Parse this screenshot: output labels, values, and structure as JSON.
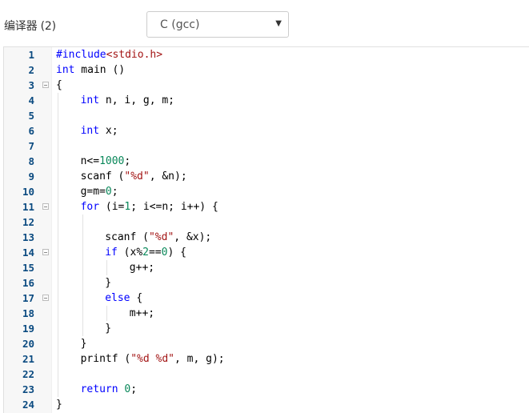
{
  "header": {
    "compiler_label": "编译器 (2)",
    "compiler_selected": "C (gcc)"
  },
  "editor": {
    "lines": [
      {
        "n": "1",
        "fold": false,
        "indent": 0,
        "tokens": [
          [
            "pre",
            "#include"
          ],
          [
            "inc",
            "<stdio.h>"
          ]
        ]
      },
      {
        "n": "2",
        "fold": false,
        "indent": 0,
        "tokens": [
          [
            "kw",
            "int"
          ],
          [
            "txt",
            " main ()"
          ]
        ]
      },
      {
        "n": "3",
        "fold": true,
        "indent": 0,
        "tokens": [
          [
            "txt",
            "{"
          ]
        ]
      },
      {
        "n": "4",
        "fold": false,
        "indent": 1,
        "tokens": [
          [
            "kw",
            "int"
          ],
          [
            "txt",
            " n, i, g, m;"
          ]
        ]
      },
      {
        "n": "5",
        "fold": false,
        "indent": 1,
        "tokens": []
      },
      {
        "n": "6",
        "fold": false,
        "indent": 1,
        "tokens": [
          [
            "kw",
            "int"
          ],
          [
            "txt",
            " x;"
          ]
        ]
      },
      {
        "n": "7",
        "fold": false,
        "indent": 1,
        "tokens": []
      },
      {
        "n": "8",
        "fold": false,
        "indent": 1,
        "tokens": [
          [
            "txt",
            "n<="
          ],
          [
            "num",
            "1000"
          ],
          [
            "txt",
            ";"
          ]
        ]
      },
      {
        "n": "9",
        "fold": false,
        "indent": 1,
        "tokens": [
          [
            "txt",
            "scanf ("
          ],
          [
            "str",
            "\"%d\""
          ],
          [
            "txt",
            ", &n);"
          ]
        ]
      },
      {
        "n": "10",
        "fold": false,
        "indent": 1,
        "tokens": [
          [
            "txt",
            "g=m="
          ],
          [
            "num",
            "0"
          ],
          [
            "txt",
            ";"
          ]
        ]
      },
      {
        "n": "11",
        "fold": true,
        "indent": 1,
        "tokens": [
          [
            "kw",
            "for"
          ],
          [
            "txt",
            " (i="
          ],
          [
            "num",
            "1"
          ],
          [
            "txt",
            "; i<=n; i++) {"
          ]
        ]
      },
      {
        "n": "12",
        "fold": false,
        "indent": 2,
        "tokens": []
      },
      {
        "n": "13",
        "fold": false,
        "indent": 2,
        "tokens": [
          [
            "txt",
            "scanf ("
          ],
          [
            "str",
            "\"%d\""
          ],
          [
            "txt",
            ", &x);"
          ]
        ]
      },
      {
        "n": "14",
        "fold": true,
        "indent": 2,
        "tokens": [
          [
            "kw",
            "if"
          ],
          [
            "txt",
            " (x%"
          ],
          [
            "num",
            "2"
          ],
          [
            "txt",
            "=="
          ],
          [
            "num",
            "0"
          ],
          [
            "txt",
            ") {"
          ]
        ]
      },
      {
        "n": "15",
        "fold": false,
        "indent": 3,
        "tokens": [
          [
            "txt",
            "g++;"
          ]
        ]
      },
      {
        "n": "16",
        "fold": false,
        "indent": 2,
        "tokens": [
          [
            "txt",
            "}"
          ]
        ]
      },
      {
        "n": "17",
        "fold": true,
        "indent": 2,
        "tokens": [
          [
            "kw",
            "else"
          ],
          [
            "txt",
            " {"
          ]
        ]
      },
      {
        "n": "18",
        "fold": false,
        "indent": 3,
        "tokens": [
          [
            "txt",
            "m++;"
          ]
        ]
      },
      {
        "n": "19",
        "fold": false,
        "indent": 2,
        "tokens": [
          [
            "txt",
            "}"
          ]
        ]
      },
      {
        "n": "20",
        "fold": false,
        "indent": 1,
        "tokens": [
          [
            "txt",
            "}"
          ]
        ]
      },
      {
        "n": "21",
        "fold": false,
        "indent": 1,
        "tokens": [
          [
            "txt",
            "printf ("
          ],
          [
            "str",
            "\"%d %d\""
          ],
          [
            "txt",
            ", m, g);"
          ]
        ]
      },
      {
        "n": "22",
        "fold": false,
        "indent": 1,
        "tokens": []
      },
      {
        "n": "23",
        "fold": false,
        "indent": 1,
        "tokens": [
          [
            "kw",
            "return"
          ],
          [
            "txt",
            " "
          ],
          [
            "num",
            "0"
          ],
          [
            "txt",
            ";"
          ]
        ]
      },
      {
        "n": "24",
        "fold": false,
        "indent": 0,
        "tokens": [
          [
            "txt",
            "}"
          ]
        ]
      }
    ]
  },
  "colors": {
    "keyword": "#0000ff",
    "number": "#09885a",
    "string": "#a31515",
    "line_number": "#0a4a80",
    "gutter_bg": "#f7f7f7"
  }
}
